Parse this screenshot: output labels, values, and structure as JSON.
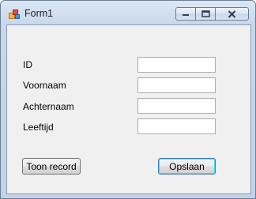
{
  "window": {
    "title": "Form1"
  },
  "form": {
    "fields": [
      {
        "label": "ID",
        "value": ""
      },
      {
        "label": "Voornaam",
        "value": ""
      },
      {
        "label": "Achternaam",
        "value": ""
      },
      {
        "label": "Leeftijd",
        "value": ""
      }
    ],
    "buttons": {
      "show_record": "Toon record",
      "save": "Opslaan"
    }
  }
}
